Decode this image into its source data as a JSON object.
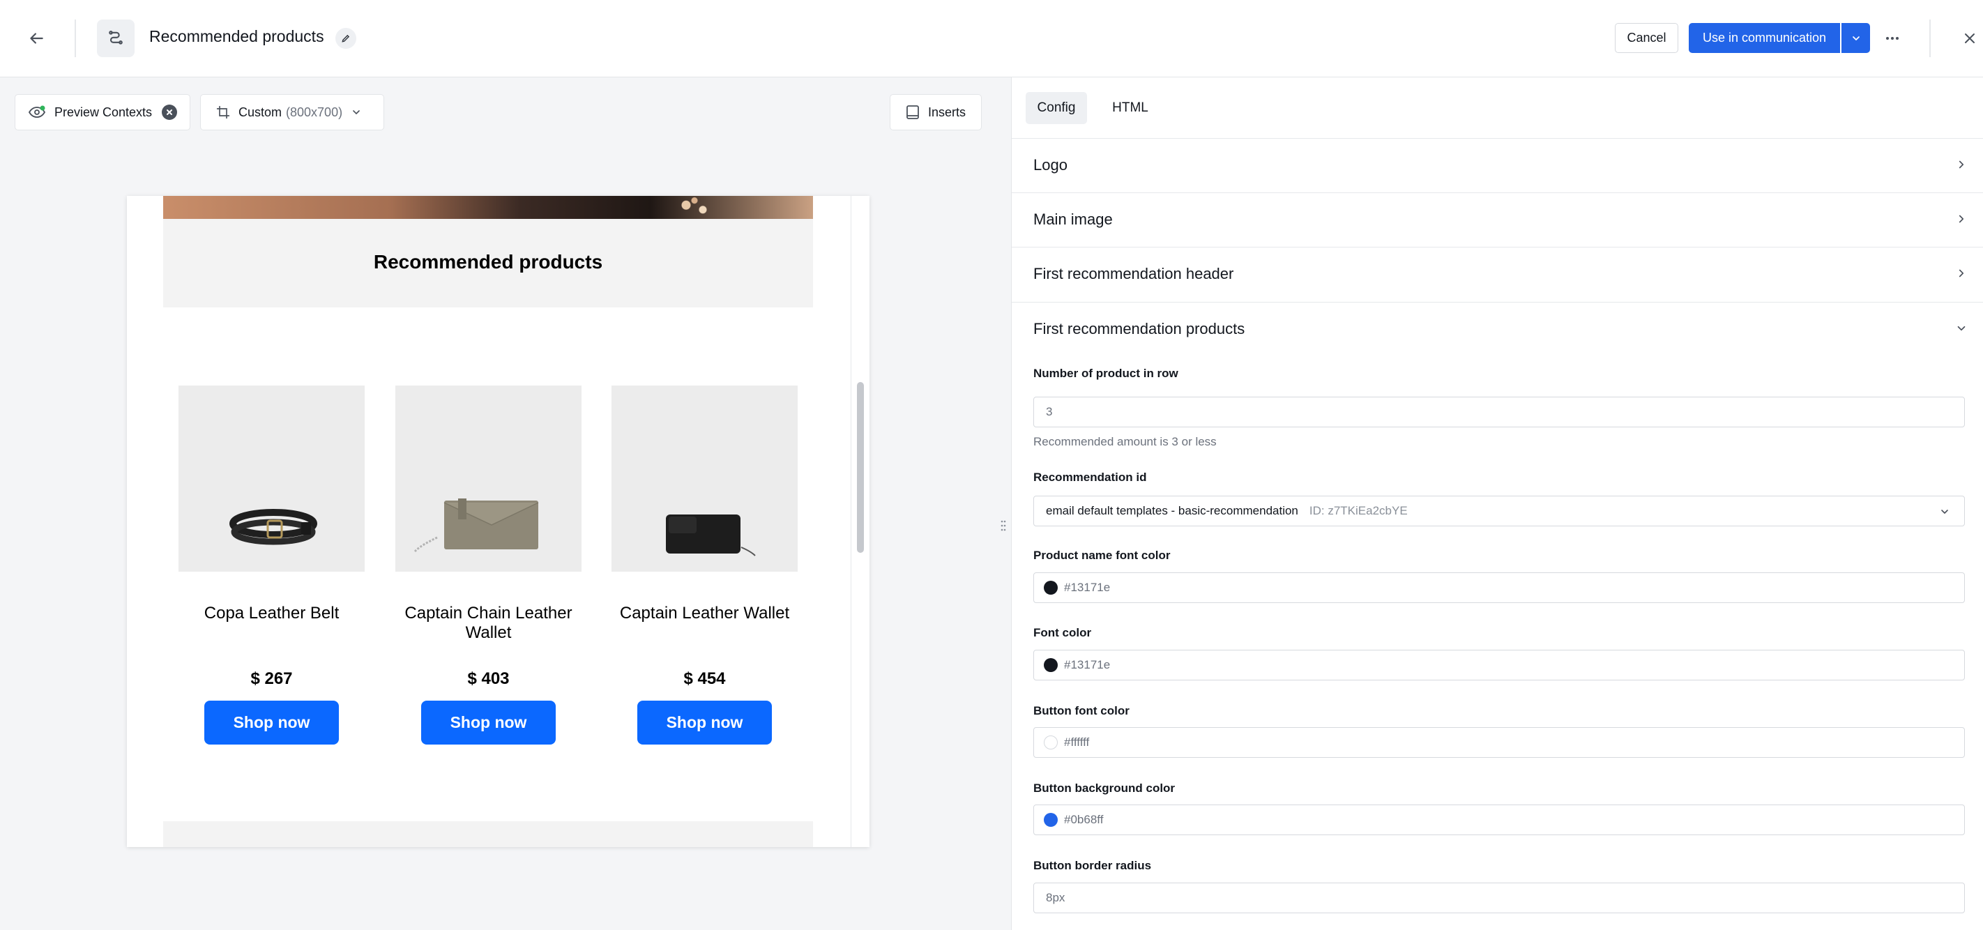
{
  "header": {
    "title": "Recommended products",
    "cancel_label": "Cancel",
    "primary_label": "Use in communication",
    "icons": {
      "back": "arrow-left-icon",
      "template": "template-icon",
      "edit": "pencil-icon",
      "more": "more-horizontal-icon",
      "close": "close-icon",
      "caret": "chevron-down-icon"
    }
  },
  "toolbar": {
    "preview_contexts_label": "Preview Contexts",
    "size_label": "Custom",
    "size_value": "(800x700)",
    "inserts_label": "Inserts"
  },
  "email": {
    "rec_title": "Recommended products",
    "shop_label": "Shop now",
    "button_color": "#0b68ff",
    "products": [
      {
        "name": "Copa Leather Belt",
        "price": "$ 267"
      },
      {
        "name": "Captain Chain Leather Wallet",
        "price": "$ 403"
      },
      {
        "name": "Captain Leather Wallet",
        "price": "$ 454"
      }
    ]
  },
  "panel": {
    "tabs": [
      {
        "label": "Config",
        "active": true
      },
      {
        "label": "HTML",
        "active": false
      }
    ],
    "sections": [
      {
        "label": "Logo",
        "expanded": false
      },
      {
        "label": "Main image",
        "expanded": false
      },
      {
        "label": "First recommendation header",
        "expanded": false
      },
      {
        "label": "First recommendation products",
        "expanded": true
      }
    ],
    "fields": {
      "per_row": {
        "label": "Number of product in row",
        "value": "3",
        "hint": "Recommended amount is 3 or less"
      },
      "rec_id": {
        "label": "Recommendation id",
        "value": "email default templates - basic-recommendation",
        "id_text": "ID: z7TKiEa2cbYE"
      },
      "name_color": {
        "label": "Product name font color",
        "value": "#13171e",
        "swatch": "#13171e"
      },
      "font_color": {
        "label": "Font color",
        "value": "#13171e",
        "swatch": "#13171e"
      },
      "btn_font_color": {
        "label": "Button font color",
        "value": "#ffffff",
        "swatch": "#ffffff"
      },
      "btn_bg_color": {
        "label": "Button background color",
        "value": "#0b68ff",
        "swatch": "#2264e8"
      },
      "btn_radius": {
        "label": "Button border radius",
        "value": "8px"
      }
    }
  },
  "colors": {
    "primary": "#2264e8",
    "text": "#13171e",
    "muted": "#6b717c"
  }
}
